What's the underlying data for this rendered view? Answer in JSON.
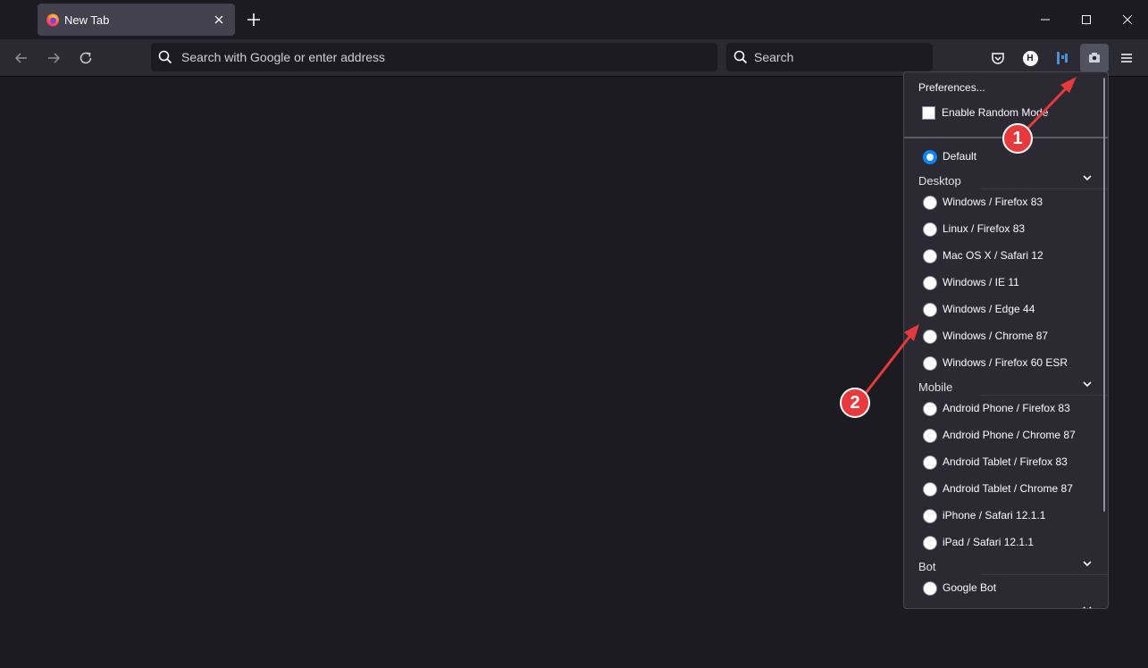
{
  "tab": {
    "title": "New Tab"
  },
  "navbar": {
    "url_placeholder": "Search with Google or enter address",
    "search_placeholder": "Search",
    "badge_letter": "H"
  },
  "popup": {
    "preferences": "Preferences...",
    "random_mode": "Enable Random Mode",
    "default_label": "Default",
    "groups": {
      "desktop": "Desktop",
      "mobile": "Mobile",
      "bot": "Bot"
    },
    "desktop": [
      "Windows / Firefox 83",
      "Linux / Firefox 83",
      "Mac OS X / Safari 12",
      "Windows / IE 11",
      "Windows / Edge 44",
      "Windows / Chrome 87",
      "Windows / Firefox 60 ESR"
    ],
    "mobile": [
      "Android Phone / Firefox 83",
      "Android Phone / Chrome 87",
      "Android Tablet / Firefox 83",
      "Android Tablet / Chrome 87",
      "iPhone / Safari 12.1.1",
      "iPad / Safari 12.1.1"
    ],
    "bot": [
      "Google Bot"
    ]
  },
  "annotations": {
    "one": "1",
    "two": "2"
  },
  "colors": {
    "accent": "#0a84ff",
    "annotation": "#e8393c"
  },
  "icons": [
    "firefox-icon",
    "close-tab-icon",
    "plus-icon",
    "minimize-icon",
    "maximize-icon",
    "window-close-icon",
    "back-icon",
    "forward-icon",
    "reload-icon",
    "search-icon",
    "pocket-icon",
    "extension-h-icon",
    "extension-bars-icon",
    "user-agent-switcher-icon",
    "menu-icon",
    "chevron-down-icon"
  ]
}
